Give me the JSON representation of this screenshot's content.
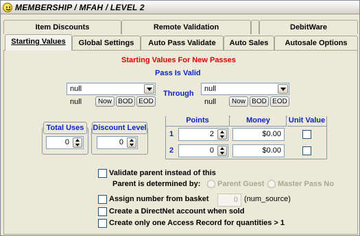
{
  "window": {
    "title": "MEMBERSHIP / MFAH / LEVEL 2"
  },
  "tabs_row1": [
    "Item Discounts",
    "Remote Validation",
    "",
    "DebitWare"
  ],
  "tabs_row2": [
    "Starting Values",
    "Global Settings",
    "Auto Pass Validate",
    "Auto Sales",
    "Autosale Options"
  ],
  "section_title": "Starting Values For New Passes",
  "pass_is_valid_label": "Pass Is Valid",
  "through_label": "Through",
  "from": {
    "combo_value": "null",
    "display": "null",
    "btn_now": "Now",
    "btn_bod": "BOD",
    "btn_eod": "EOD"
  },
  "to": {
    "combo_value": "null",
    "display": "null",
    "btn_now": "Now",
    "btn_bod": "BOD",
    "btn_eod": "EOD"
  },
  "total_uses": {
    "label": "Total Uses",
    "value": "0"
  },
  "discount_level": {
    "label": "Discount Level",
    "value": "0"
  },
  "points_table": {
    "headers": [
      "Points",
      "Money",
      "Unit Value"
    ],
    "rows": [
      {
        "index": "1",
        "points": "2",
        "money": "$0.00",
        "unit_value": false
      },
      {
        "index": "2",
        "points": "0",
        "money": "$0.00",
        "unit_value": false
      }
    ]
  },
  "validate_parent": {
    "label": "Validate parent instead of this",
    "checked": false
  },
  "parent_determined": {
    "label": "Parent is determined by:",
    "options": [
      "Parent Guest",
      "Master Pass No"
    ]
  },
  "assign_number": {
    "label": "Assign number from basket",
    "value": "0",
    "suffix": "(num_source)",
    "checked": false
  },
  "directnet": {
    "label": "Create a DirectNet account when sold",
    "checked": false
  },
  "access_record": {
    "label": "Create only one Access Record for quantities > 1",
    "checked": false
  },
  "colors": {
    "section_title": "#e00000",
    "group_label": "#0a24c8"
  }
}
